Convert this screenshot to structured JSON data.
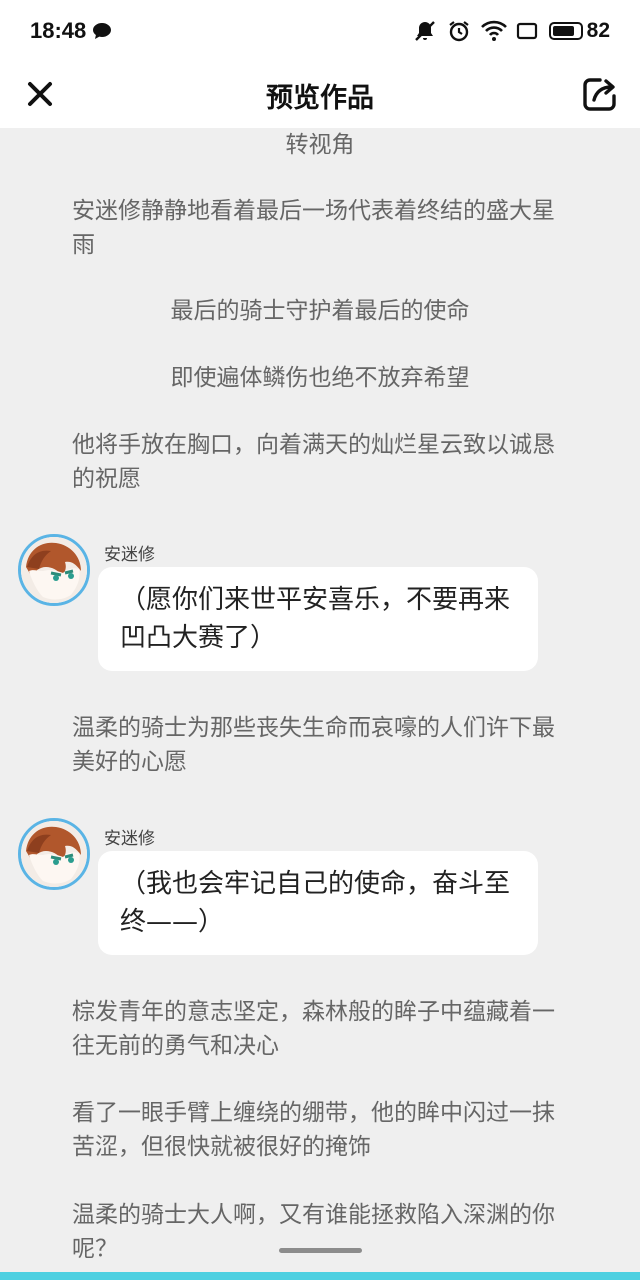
{
  "status_bar": {
    "time": "18:48",
    "icons": [
      "chat-icon",
      "mute-icon",
      "alarm-icon",
      "wifi-icon",
      "screen-icon",
      "battery-icon"
    ],
    "battery_level": "82"
  },
  "header": {
    "title": "预览作品",
    "close_icon": "close-icon",
    "share_icon": "share-icon"
  },
  "story": {
    "p0": "转视角",
    "p1": "安迷修静静地看着最后一场代表着终结的盛大星雨",
    "p2": "最后的骑士守护着最后的使命",
    "p3": "即使遍体鳞伤也绝不放弃希望",
    "p4": "他将手放在胸口，向着满天的灿烂星云致以诚恳的祝愿",
    "dialog1": {
      "speaker": "安迷修",
      "text": "（愿你们来世平安喜乐，不要再来凹凸大赛了）"
    },
    "p5": "温柔的骑士为那些丧失生命而哀嚎的人们许下最美好的心愿",
    "dialog2": {
      "speaker": "安迷修",
      "text": "（我也会牢记自己的使命，奋斗至终——）"
    },
    "p6": "棕发青年的意志坚定，森林般的眸子中蕴藏着一往无前的勇气和决心",
    "p7": "看了一眼手臂上缠绕的绷带，他的眸中闪过一抹苦涩，但很快就被很好的掩饰",
    "p8": "温柔的骑士大人啊，又有谁能拯救陷入深渊的你呢？"
  },
  "colors": {
    "avatar_ring": "#5ab4e5",
    "bottom_strip": "#4dd0e1",
    "background": "#efefef"
  }
}
